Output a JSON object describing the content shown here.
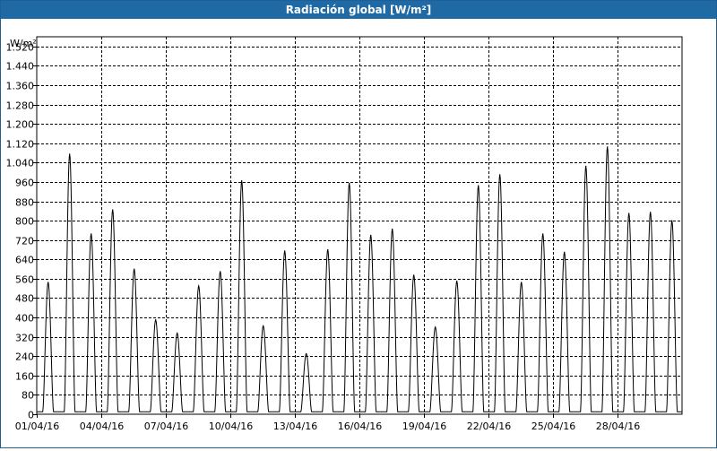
{
  "window": {
    "title": "Radiación global [W/m²]"
  },
  "chart_data": {
    "type": "line",
    "title": "Radiación global [W/m²]",
    "ylabel": "W/m²",
    "xlabel": "",
    "ylim": [
      0,
      1560
    ],
    "x_start_date": "01/04/16",
    "x_end_date": "30/04/16",
    "days_shown": 30,
    "y_ticks": [
      0,
      80,
      160,
      240,
      320,
      400,
      480,
      560,
      640,
      720,
      800,
      880,
      960,
      1040,
      1120,
      1200,
      1280,
      1360,
      1440,
      1520
    ],
    "y_tick_labels": [
      "0",
      "80",
      "160",
      "240",
      "320",
      "400",
      "480",
      "560",
      "640",
      "720",
      "800",
      "880",
      "960",
      "1.040",
      "1.120",
      "1.200",
      "1.280",
      "1.360",
      "1.440",
      "1.520"
    ],
    "x_tick_days": [
      0,
      3,
      6,
      9,
      12,
      15,
      18,
      21,
      24,
      27
    ],
    "x_tick_labels": [
      "01/04/16",
      "04/04/16",
      "07/04/16",
      "10/04/16",
      "13/04/16",
      "16/04/16",
      "19/04/16",
      "22/04/16",
      "25/04/16",
      "28/04/16"
    ],
    "grid": true,
    "series": [
      {
        "name": "",
        "color": "#000000",
        "daily_peaks": [
          545,
          1075,
          745,
          845,
          600,
          390,
          335,
          530,
          590,
          965,
          365,
          675,
          250,
          680,
          955,
          740,
          765,
          575,
          360,
          550,
          945,
          990,
          545,
          745,
          670,
          1025,
          1105,
          830,
          835,
          800
        ]
      }
    ]
  }
}
